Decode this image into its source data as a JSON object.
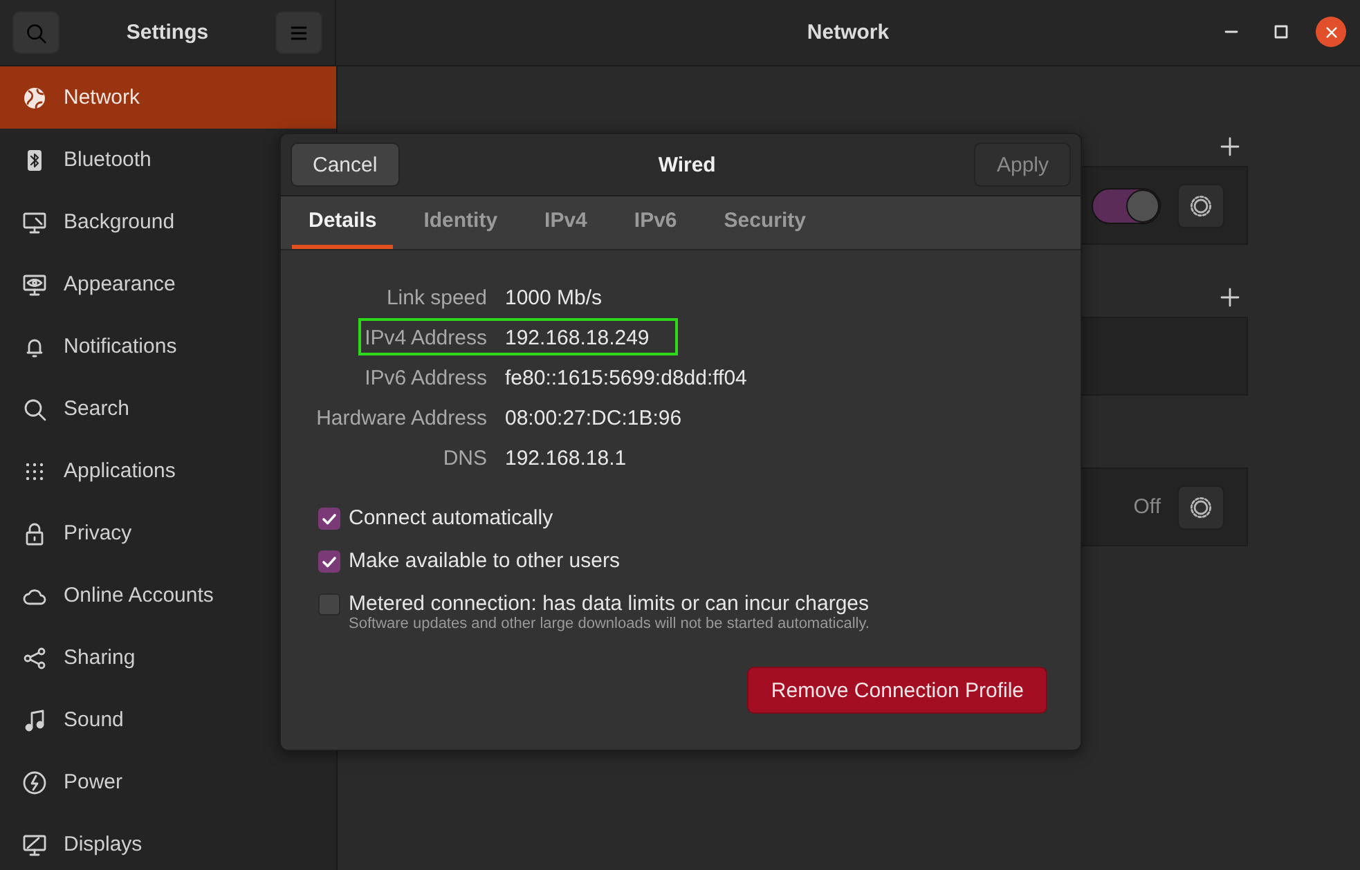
{
  "window": {
    "title": "Network",
    "sidebar_title": "Settings"
  },
  "sidebar": {
    "items": [
      {
        "label": "Network",
        "selected": true
      },
      {
        "label": "Bluetooth",
        "selected": false
      },
      {
        "label": "Background",
        "selected": false
      },
      {
        "label": "Appearance",
        "selected": false
      },
      {
        "label": "Notifications",
        "selected": false
      },
      {
        "label": "Search",
        "selected": false
      },
      {
        "label": "Applications",
        "selected": false
      },
      {
        "label": "Privacy",
        "selected": false
      },
      {
        "label": "Online Accounts",
        "selected": false
      },
      {
        "label": "Sharing",
        "selected": false
      },
      {
        "label": "Sound",
        "selected": false
      },
      {
        "label": "Power",
        "selected": false
      },
      {
        "label": "Displays",
        "selected": false
      }
    ]
  },
  "groups": [
    {
      "add_button": true,
      "card": {
        "kind": "toggle",
        "on": true
      }
    },
    {
      "add_button": true,
      "card": {
        "kind": "empty"
      }
    },
    {
      "add_button": false,
      "card": {
        "kind": "status",
        "status": "Off"
      }
    }
  ],
  "dialog": {
    "title": "Wired",
    "cancel": "Cancel",
    "apply": {
      "label": "Apply",
      "disabled": true
    },
    "tabs": [
      {
        "label": "Details",
        "selected": true
      },
      {
        "label": "Identity",
        "selected": false
      },
      {
        "label": "IPv4",
        "selected": false
      },
      {
        "label": "IPv6",
        "selected": false
      },
      {
        "label": "Security",
        "selected": false
      }
    ],
    "details": [
      {
        "label": "Link speed",
        "value": "1000 Mb/s",
        "highlighted": false
      },
      {
        "label": "IPv4 Address",
        "value": "192.168.18.249",
        "highlighted": true
      },
      {
        "label": "IPv6 Address",
        "value": "fe80::1615:5699:d8dd:ff04",
        "highlighted": false
      },
      {
        "label": "Hardware Address",
        "value": "08:00:27:DC:1B:96",
        "highlighted": false
      },
      {
        "label": "DNS",
        "value": "192.168.18.1",
        "highlighted": false
      }
    ],
    "options": [
      {
        "label": "Connect automatically",
        "checked": true
      },
      {
        "label": "Make available to other users",
        "checked": true
      },
      {
        "label": "Metered connection: has data limits or can incur charges",
        "hint": "Software updates and other large downloads will not be started automatically.",
        "checked": false
      }
    ],
    "remove_button": "Remove Connection Profile"
  }
}
